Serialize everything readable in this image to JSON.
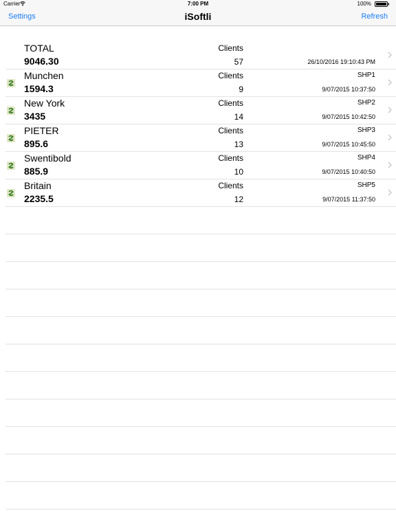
{
  "status_bar": {
    "carrier": "Carrier",
    "time": "7:00 PM",
    "battery": "100%"
  },
  "nav": {
    "title": "iSoftli",
    "left_button": "Settings",
    "right_button": "Refresh"
  },
  "total": {
    "name": "TOTAL",
    "value": "9046.30",
    "label": "Clients",
    "count": "57",
    "code": "",
    "date": "26/10/2016 19:10:43 PM"
  },
  "shops": [
    {
      "name": "Munchen",
      "value": "1594.3",
      "label": "Clients",
      "count": "9",
      "code": "SHP1",
      "date": "9/07/2015 10:37:50"
    },
    {
      "name": "New York",
      "value": "3435",
      "label": "Clients",
      "count": "14",
      "code": "SHP2",
      "date": "9/07/2015 10:42:50"
    },
    {
      "name": "PIETER",
      "value": "895.6",
      "label": "Clients",
      "count": "13",
      "code": "SHP3",
      "date": "9/07/2015 10:45:50"
    },
    {
      "name": "Swentibold",
      "value": "885.9",
      "label": "Clients",
      "count": "10",
      "code": "SHP4",
      "date": "9/07/2015 10:40:50"
    },
    {
      "name": "Britain",
      "value": "2235.5",
      "label": "Clients",
      "count": "12",
      "code": "SHP5",
      "date": "9/07/2015 11:37:50"
    }
  ],
  "icons": {
    "shop": "shop-icon",
    "chevron": "chevron-right-icon",
    "wifi": "wifi-icon",
    "battery": "battery-icon"
  },
  "colors": {
    "accent": "#1a7cf0",
    "separator": "#e2e2e6",
    "bar_background": "#f7f7f7"
  }
}
